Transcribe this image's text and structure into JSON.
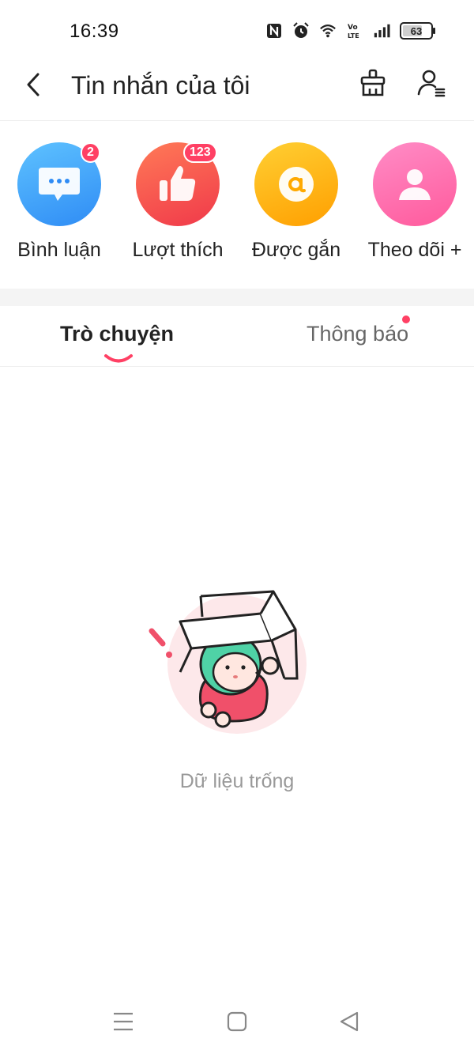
{
  "status_bar": {
    "time": "16:39",
    "battery": "63",
    "icons": [
      "nfc-icon",
      "alarm-icon",
      "wifi-icon",
      "volte-icon",
      "signal-icon",
      "battery-icon"
    ]
  },
  "header": {
    "title": "Tin nhắn của tôi",
    "icons": [
      "back-arrow-icon",
      "broom-icon",
      "people-settings-icon"
    ]
  },
  "categories": [
    {
      "label": "Bình luận",
      "badge": "2",
      "icon": "comment-bubble-icon",
      "color": "#3ea6ff"
    },
    {
      "label": "Lượt thích",
      "badge": "123",
      "icon": "thumbs-up-icon",
      "color": "#ff5a4d"
    },
    {
      "label": "Được gắn",
      "badge": "",
      "icon": "at-sign-icon",
      "color": "#ffb300"
    },
    {
      "label": "Theo dõi +",
      "badge": "",
      "icon": "person-icon",
      "color": "#ff6fae"
    }
  ],
  "tabs": [
    {
      "label": "Trò chuyện",
      "active": true
    },
    {
      "label": "Thông báo",
      "active": false,
      "has_dot": true
    }
  ],
  "empty_state": {
    "message": "Dữ liệu trống",
    "icon": "empty-box-character-illustration"
  },
  "nav_bar": {
    "icons": [
      "menu-icon",
      "home-icon",
      "back-triangle-icon"
    ]
  },
  "colors": {
    "accent": "#ff4064",
    "text_primary": "#222222",
    "text_muted": "#999999"
  }
}
